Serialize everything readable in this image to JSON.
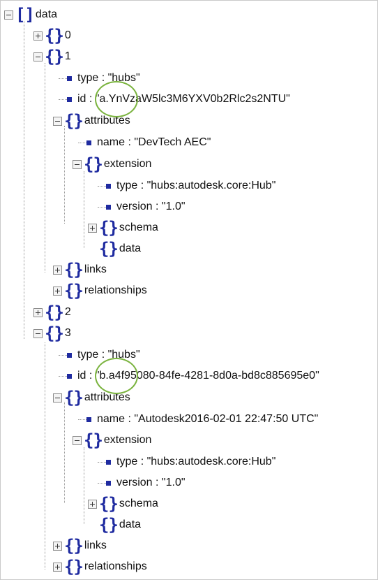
{
  "root": {
    "label": "data"
  },
  "items": [
    {
      "label": "0"
    },
    {
      "label": "1",
      "type_line": "type : \"hubs\"",
      "id_line": "id : \"a.YnVzaW5lc3M6YXV0b2Rlc2s2NTU\"",
      "attributes": "attributes",
      "name_line": "name : \"DevTech AEC\"",
      "extension": "extension",
      "ext_type_line": "type : \"hubs:autodesk.core:Hub\"",
      "ext_version_line": "version : \"1.0\"",
      "schema": "schema",
      "data": "data",
      "links": "links",
      "relationships": "relationships"
    },
    {
      "label": "2"
    },
    {
      "label": "3",
      "type_line": "type : \"hubs\"",
      "id_line": "id : \"b.a4f95080-84fe-4281-8d0a-bd8c885695e0\"",
      "attributes": "attributes",
      "name_line": "name : \"Autodesk2016-02-01 22:47:50 UTC\"",
      "extension": "extension",
      "ext_type_line": "type : \"hubs:autodesk.core:Hub\"",
      "ext_version_line": "version : \"1.0\"",
      "schema": "schema",
      "data": "data",
      "links": "links",
      "relationships": "relationships"
    }
  ],
  "icons": {
    "array": "[ ]",
    "object": "{ }",
    "leaf": "square-bullet"
  },
  "colors": {
    "glyph": "#1f2ba0",
    "highlight": "#7ab33e"
  }
}
